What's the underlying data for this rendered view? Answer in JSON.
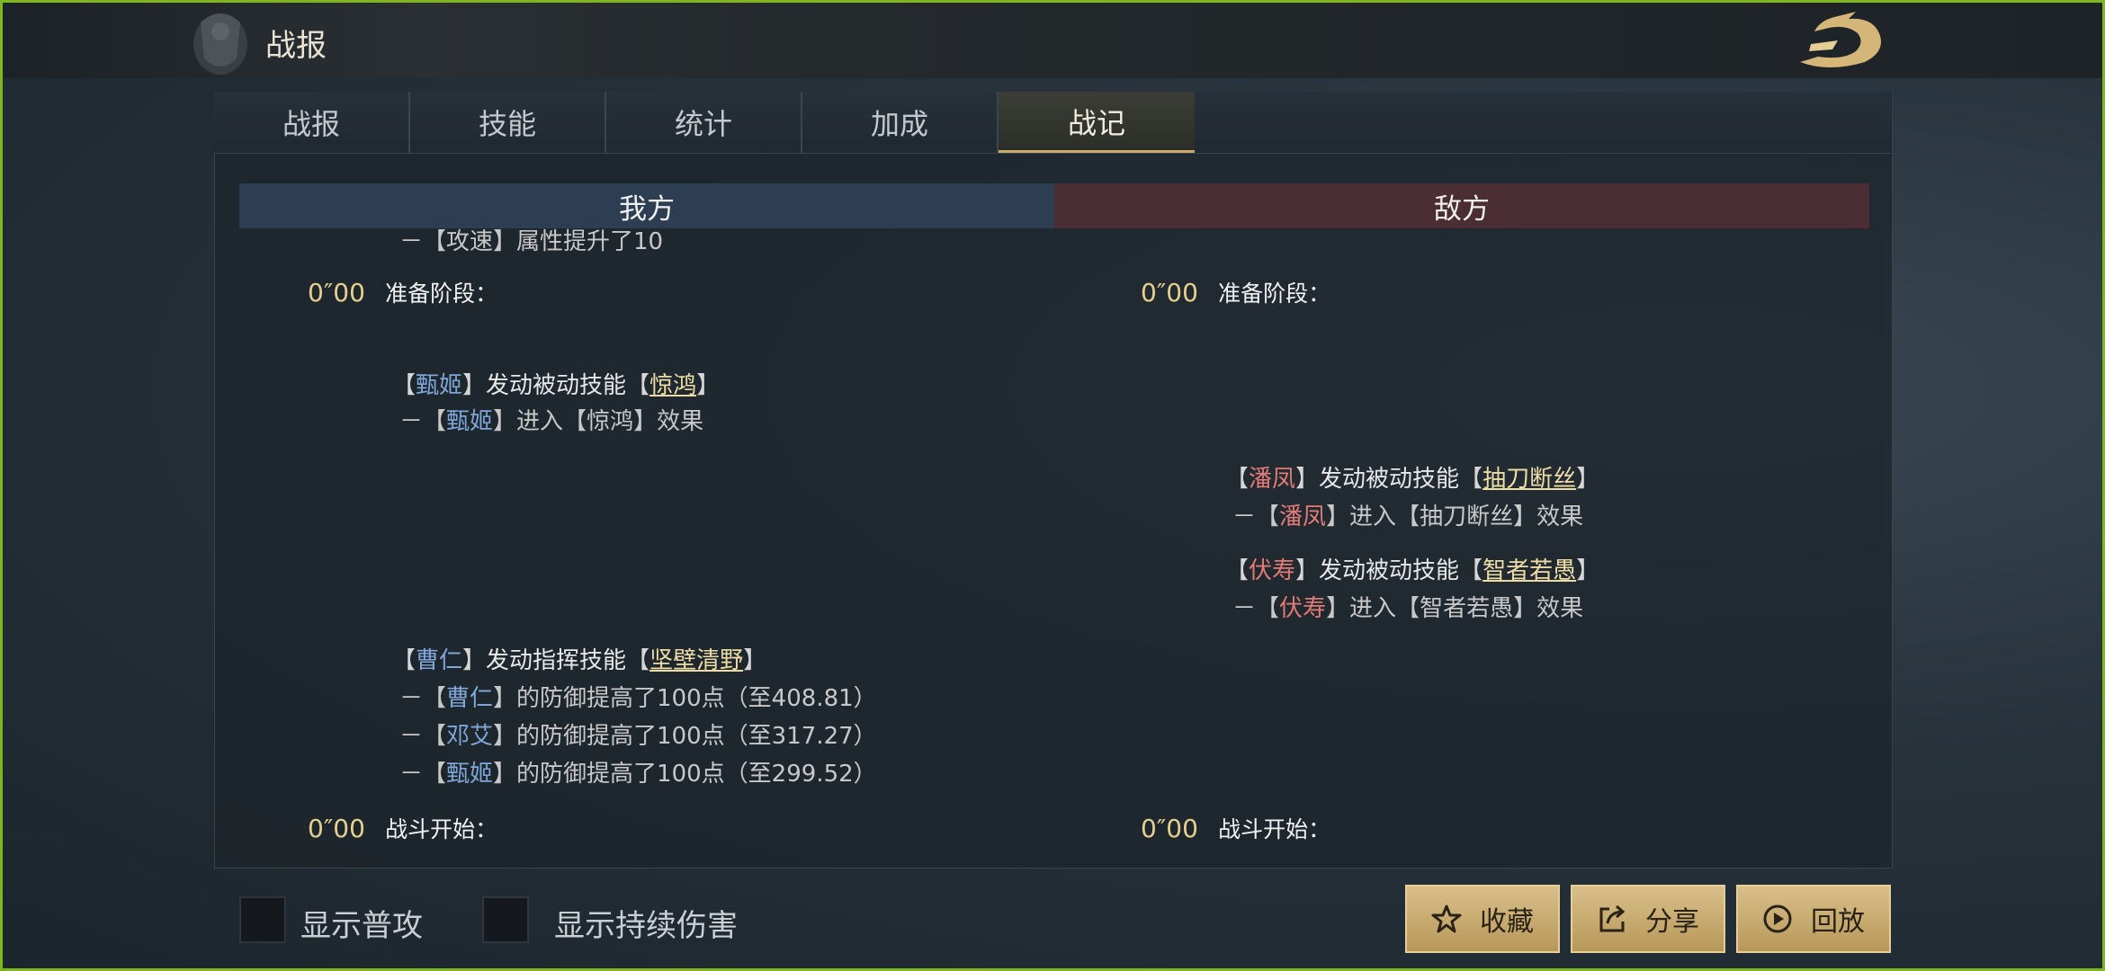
{
  "header": {
    "title": "战报"
  },
  "tabs": [
    {
      "label": "战报",
      "active": false
    },
    {
      "label": "技能",
      "active": false
    },
    {
      "label": "统计",
      "active": false
    },
    {
      "label": "加成",
      "active": false
    },
    {
      "label": "战记",
      "active": true
    }
  ],
  "columns": {
    "mine": "我方",
    "enemy": "敌方"
  },
  "mine_log": {
    "clipped_line": "－【攻速】属性提升了10",
    "prep": {
      "time": "0″00",
      "text": "准备阶段："
    },
    "zhenji_trigger": {
      "who": "甄姬",
      "action": "发动被动技能",
      "skill": "惊鸿"
    },
    "zhenji_enter": {
      "who": "甄姬",
      "pre": "进入",
      "effect": "惊鸿",
      "post": "效果"
    },
    "caoren_trigger": {
      "who": "曹仁",
      "action": "发动指挥技能",
      "skill": "坚壁清野"
    },
    "def_lines": [
      {
        "who": "曹仁",
        "text": "的防御提高了100点（至408.81）"
      },
      {
        "who": "邓艾",
        "text": "的防御提高了100点（至317.27）"
      },
      {
        "who": "甄姬",
        "text": "的防御提高了100点（至299.52）"
      }
    ],
    "battle": {
      "time": "0″00",
      "text": "战斗开始："
    }
  },
  "enemy_log": {
    "prep": {
      "time": "0″00",
      "text": "准备阶段："
    },
    "panfeng_trigger": {
      "who": "潘凤",
      "action": "发动被动技能",
      "skill": "抽刀断丝"
    },
    "panfeng_enter": {
      "who": "潘凤",
      "pre": "进入",
      "effect": "抽刀断丝",
      "post": "效果"
    },
    "fushou_trigger": {
      "who": "伏寿",
      "action": "发动被动技能",
      "skill": "智者若愚"
    },
    "fushou_enter": {
      "who": "伏寿",
      "pre": "进入",
      "effect": "智者若愚",
      "post": "效果"
    },
    "battle": {
      "time": "0″00",
      "text": "战斗开始："
    }
  },
  "bottom": {
    "show_normal_attack": "显示普攻",
    "show_dot": "显示持续伤害",
    "favorite": "收藏",
    "share": "分享",
    "replay": "回放"
  },
  "icons": [
    "star-icon",
    "share-icon",
    "play-icon",
    "dragon-logo-icon"
  ],
  "colors": {
    "gold": "#c8aa6a",
    "ally": "#7fa6d9",
    "foe": "#e07b76",
    "frame": "#7fb51f"
  }
}
